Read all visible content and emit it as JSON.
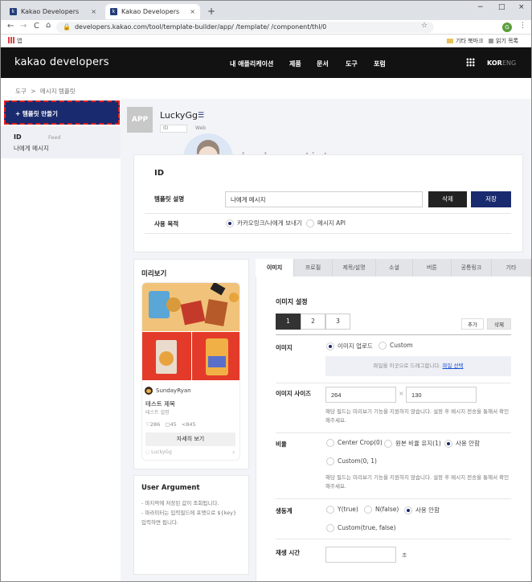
{
  "browser": {
    "tabs": [
      {
        "title": "Kakao Developers",
        "close": "×"
      },
      {
        "title": "Kakao Developers",
        "close": "×"
      }
    ],
    "new_tab": "+",
    "window_controls": [
      "−",
      "□",
      "×"
    ],
    "nav": {
      "back": "←",
      "forward": "→",
      "reload": "C",
      "home": "⌂"
    },
    "url": "developers.kakao.com/tool/template-builder/app/          /template/          /component/thl/0",
    "star": "☆",
    "profile_initial": "G",
    "menu": "⋮",
    "bookmarks": {
      "apps_label": "앱",
      "other_bookmarks": "기타 북마크",
      "reading_list": "읽기 목록"
    }
  },
  "header": {
    "logo": "kakao developers",
    "nav": [
      "내 애플리케이션",
      "제품",
      "문서",
      "도구",
      "포럼"
    ],
    "lang_active": "KOR",
    "lang_inactive": "ENG"
  },
  "breadcrumb": {
    "root": "도구",
    "sep": ">",
    "current": "메시지 템플릿"
  },
  "sidebar": {
    "make_button": "+ 템플릿 만들기",
    "item": {
      "id": "ID",
      "type": "Feed",
      "desc": "나에게 메시지"
    }
  },
  "app": {
    "tile": "APP",
    "name": "LuckyGg",
    "id_label": "ID",
    "web_label": "Web"
  },
  "watermark": "luckygg.tistory.com",
  "template": {
    "id_label": "ID",
    "desc_label": "템플릿 설명",
    "desc_value": "나에게 메시지",
    "delete": "삭제",
    "save": "저장",
    "purpose_label": "사용 목적",
    "purpose_options": [
      "카카오링크/나에게 보내기",
      "메시지 API"
    ],
    "purpose_selected": 0
  },
  "preview": {
    "title": "미리보기",
    "profile_name": "SundayRyan",
    "card_title": "테스트 제목",
    "card_desc": "테스트 설명",
    "likes": "286",
    "comments": "45",
    "shares": "845",
    "detail_button": "자세히 보기",
    "footer": "LuckyGg",
    "footer_arrow": "›"
  },
  "user_argument": {
    "title": "User Argument",
    "lines": [
      "- 마지막에 저장된 값이 조회됩니다.",
      "- 파라미터는 입력필드에 포맷으로 ${key}",
      "입력하면 됩니다."
    ]
  },
  "editor": {
    "tabs": [
      "이미지",
      "프로필",
      "제목/설명",
      "소셜",
      "버튼",
      "공통링크",
      "기타"
    ],
    "active_tab": 0,
    "section_title": "이미지 설정",
    "segments": [
      "1",
      "2",
      "3"
    ],
    "add": "추가",
    "remove": "삭제",
    "image_label": "이미지",
    "image_options": [
      "이미지 업로드",
      "Custom"
    ],
    "image_selected": 0,
    "drop_text": "파일을 이곳으로 드래그합니다.",
    "drop_link": "파일 선택",
    "size_label": "이미지 사이즈",
    "width": "264",
    "times": "×",
    "height": "130",
    "size_note": "해당 필드는 미리보기 기능을 지원하지 않습니다. 설정 후 메시지 전송을 통해서 확인해주세요.",
    "ratio_label": "비율",
    "ratio_options": [
      "Center Crop(0)",
      "원본 비율 유지(1)",
      "사용 안함",
      "Custom(0, 1)"
    ],
    "ratio_selected": 2,
    "ratio_note": "해당 필드는 미리보기 기능을 지원하지 않습니다. 설정 후 메시지 전송을 통해서 확인해주세요.",
    "anim_label": "생동계",
    "anim_options": [
      "Y(true)",
      "N(false)",
      "사용 안함",
      "Custom(true, false)"
    ],
    "anim_selected": 2,
    "duration_label": "재생 시간",
    "duration_unit": "초"
  }
}
